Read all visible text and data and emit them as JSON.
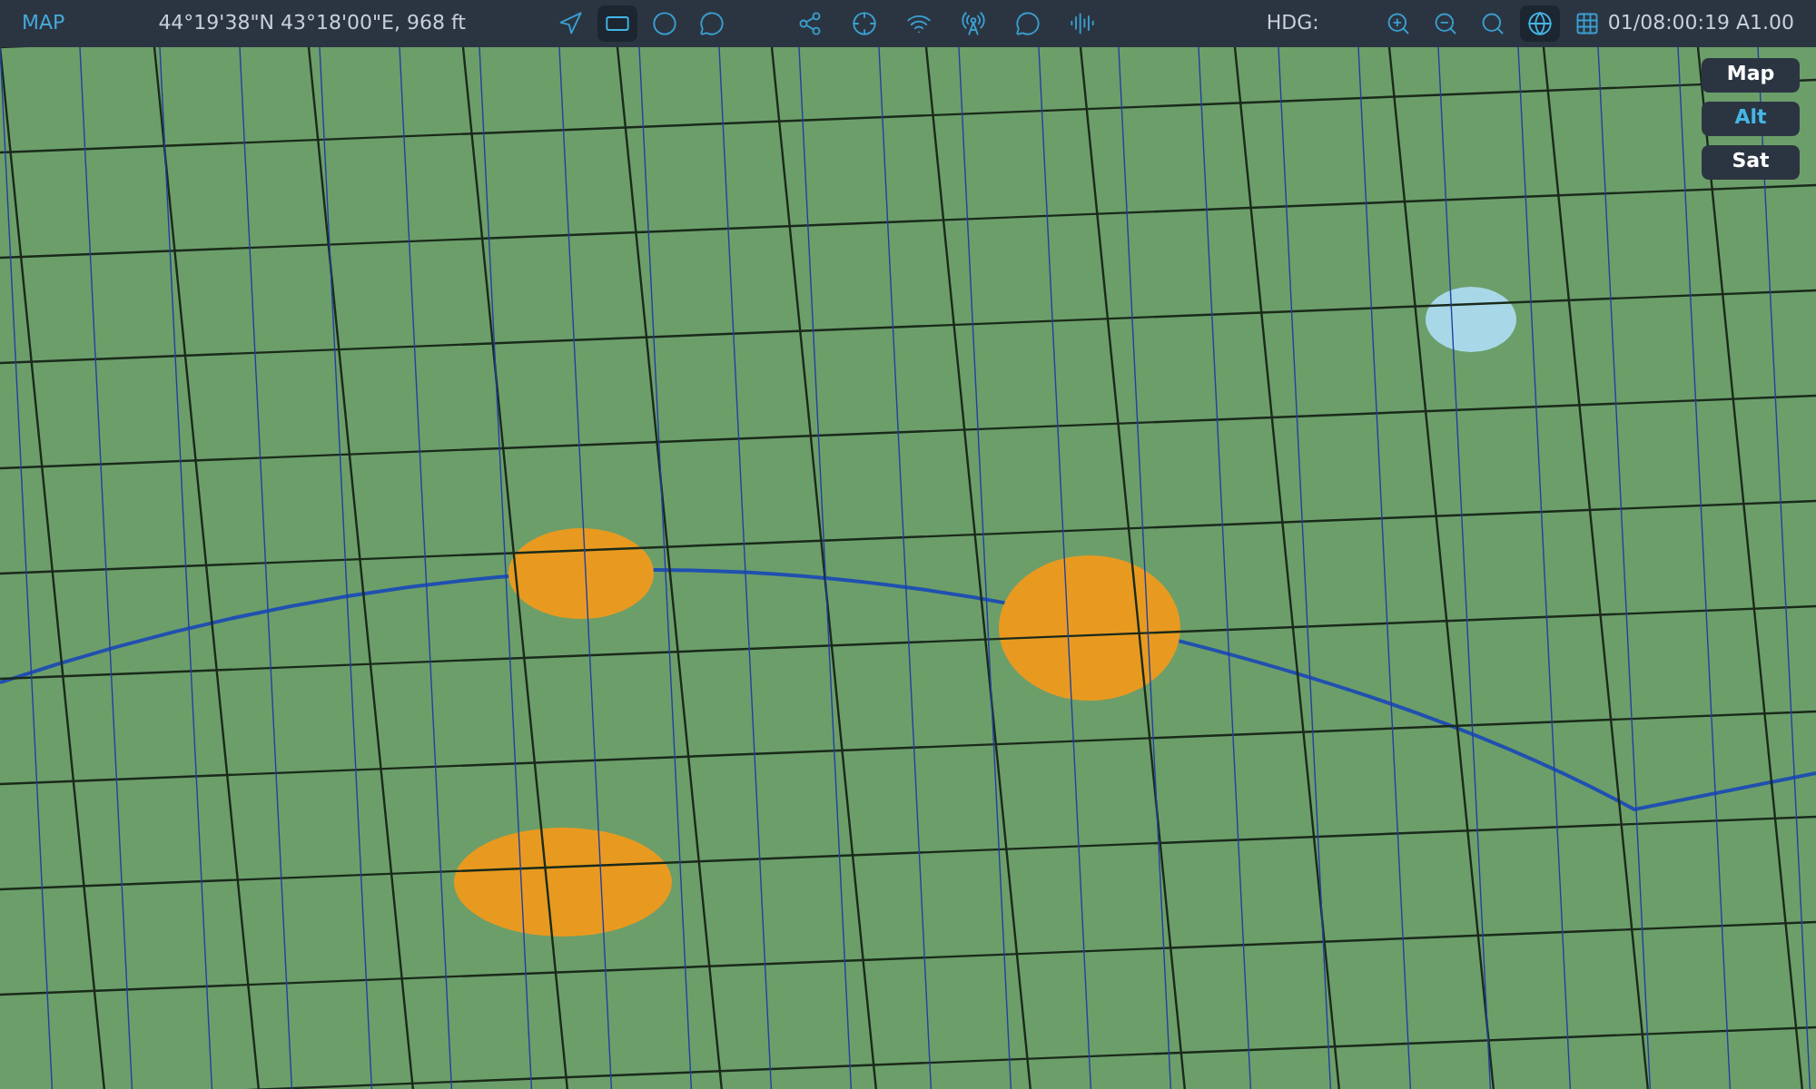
{
  "toolbar": {
    "title": "MAP",
    "position": "44°19'38\"N 43°18'00\"E, 968 ft",
    "tools": [
      {
        "selected": false
      },
      {
        "selected": true
      },
      {
        "selected": false
      },
      {
        "selected": false
      }
    ],
    "heading": "HDG:",
    "views": [
      {
        "selected": true
      },
      {
        "selected": false
      }
    ],
    "time": "01/08:00:19 A1.00"
  },
  "map_modes": [
    {
      "label": "Map",
      "selected": false
    },
    {
      "label": "Alt",
      "selected": true
    },
    {
      "label": "Sat",
      "selected": false
    }
  ]
}
